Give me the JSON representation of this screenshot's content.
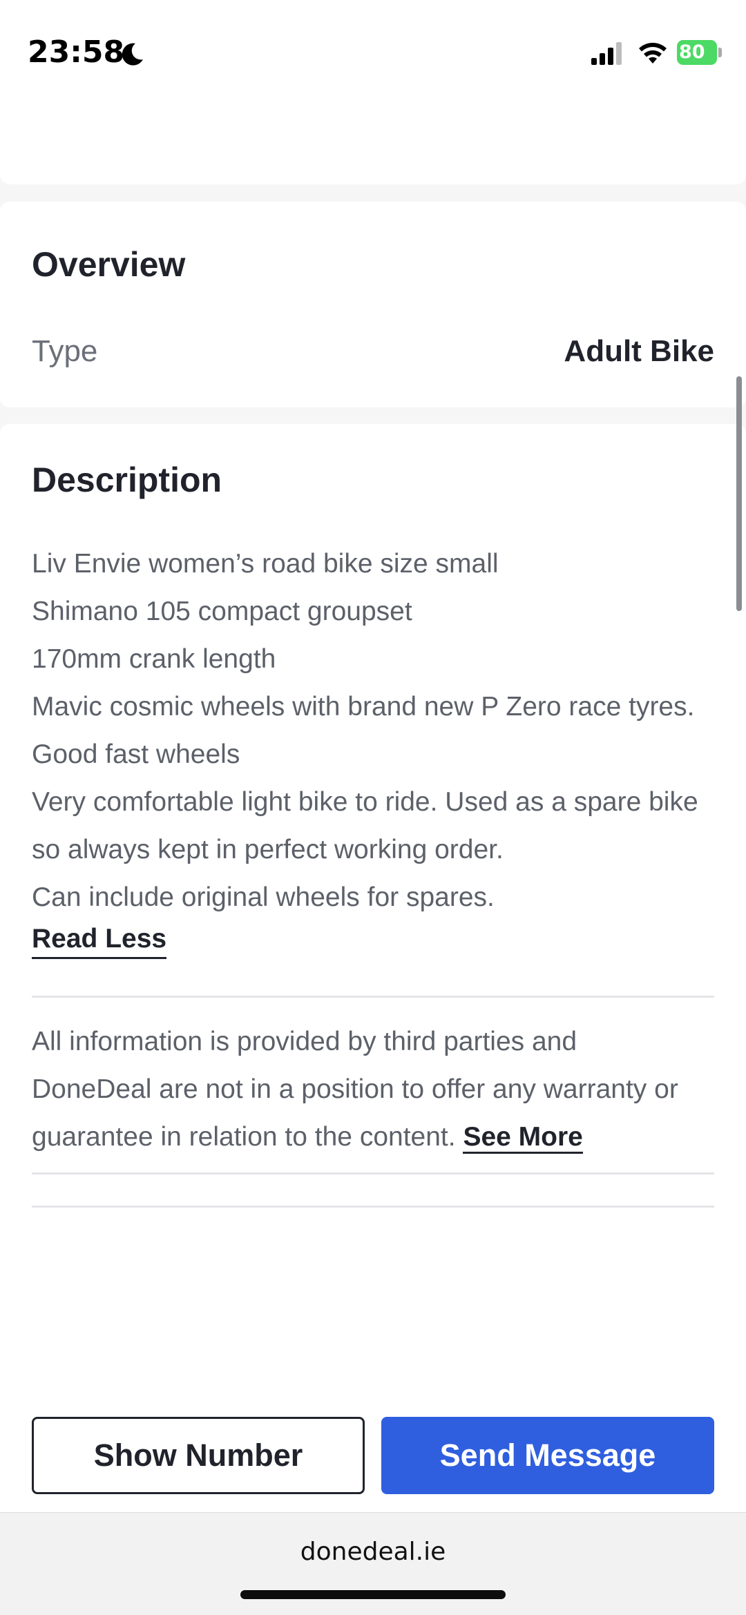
{
  "status_bar": {
    "time": "23:58",
    "battery_level": "80",
    "icons": [
      "moon-icon",
      "signal-icon",
      "wifi-icon",
      "battery-icon"
    ]
  },
  "overview": {
    "title": "Overview",
    "type_label": "Type",
    "type_value": "Adult Bike"
  },
  "description": {
    "title": "Description",
    "lines": [
      "Liv Envie women’s road bike size small",
      "Shimano 105 compact groupset",
      "170mm crank length",
      "Mavic cosmic wheels with brand new P Zero race tyres.",
      "Good fast wheels",
      "Very comfortable light bike to ride. Used as a spare bike",
      "so always kept in perfect working order.",
      "Can include original wheels for spares."
    ],
    "read_less_label": "Read Less"
  },
  "disclaimer": {
    "line1": "All information is provided by third parties and",
    "line2": "DoneDeal are not in a position to offer any warranty or",
    "line3": "guarantee in relation to the content.",
    "see_more_label": "See More"
  },
  "actions": {
    "show_number_label": "Show Number",
    "send_message_label": "Send Message"
  },
  "browser": {
    "url": "donedeal.ie"
  },
  "colors": {
    "primary_button": "#2f5fdf",
    "battery": "#4cd964",
    "text_dark": "#20232b",
    "text_muted": "#5c6069"
  }
}
